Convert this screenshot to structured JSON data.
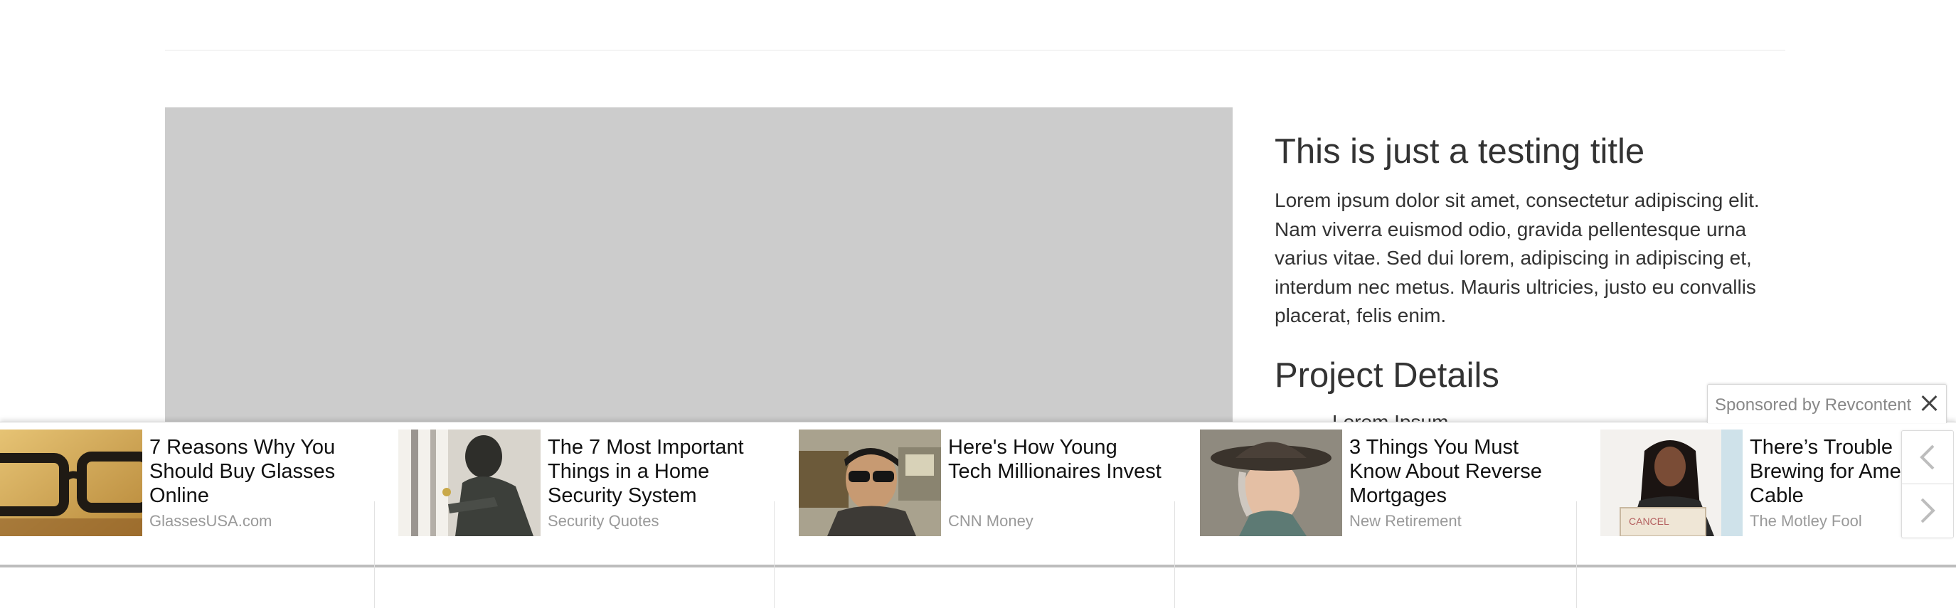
{
  "article": {
    "title": "This is just a testing title",
    "description": "Lorem ipsum dolor sit amet, consectetur adipiscing elit. Nam viverra euismod odio, gravida pellentesque urna varius vitae. Sed dui lorem, adipiscing in adipiscing et, interdum nec metus. Mauris ultricies, justo eu convallis placerat, felis enim.",
    "details_heading": "Project Details",
    "details_items": [
      "Lorem Ipsum"
    ]
  },
  "sponsored": {
    "label": "Sponsored by Revcontent",
    "close_icon": "close-icon",
    "nav": {
      "prev_icon": "chevron-left-icon",
      "next_icon": "chevron-right-icon"
    },
    "ads": [
      {
        "title": "7 Reasons Why You Should Buy Glasses Online",
        "source": "GlassesUSA.com",
        "thumb": "glasses-thumbnail"
      },
      {
        "title": "The 7 Most Important Things in a Home Security System",
        "source": "Security Quotes",
        "thumb": "burglar-thumbnail"
      },
      {
        "title": "Here's How Young Tech Millionaires Invest",
        "source": "CNN Money",
        "thumb": "young-man-sunglasses-thumbnail"
      },
      {
        "title": "3 Things You Must Know About Reverse Mortgages",
        "source": "New Retirement",
        "thumb": "older-woman-hat-thumbnail"
      },
      {
        "title": "There’s Trouble Brewing for America’s Cable",
        "source": "The Motley Fool",
        "thumb": "woman-cancel-sign-thumbnail"
      }
    ]
  },
  "colors": {
    "placeholder": "#cccccc",
    "text": "#333333",
    "source": "#999999"
  }
}
